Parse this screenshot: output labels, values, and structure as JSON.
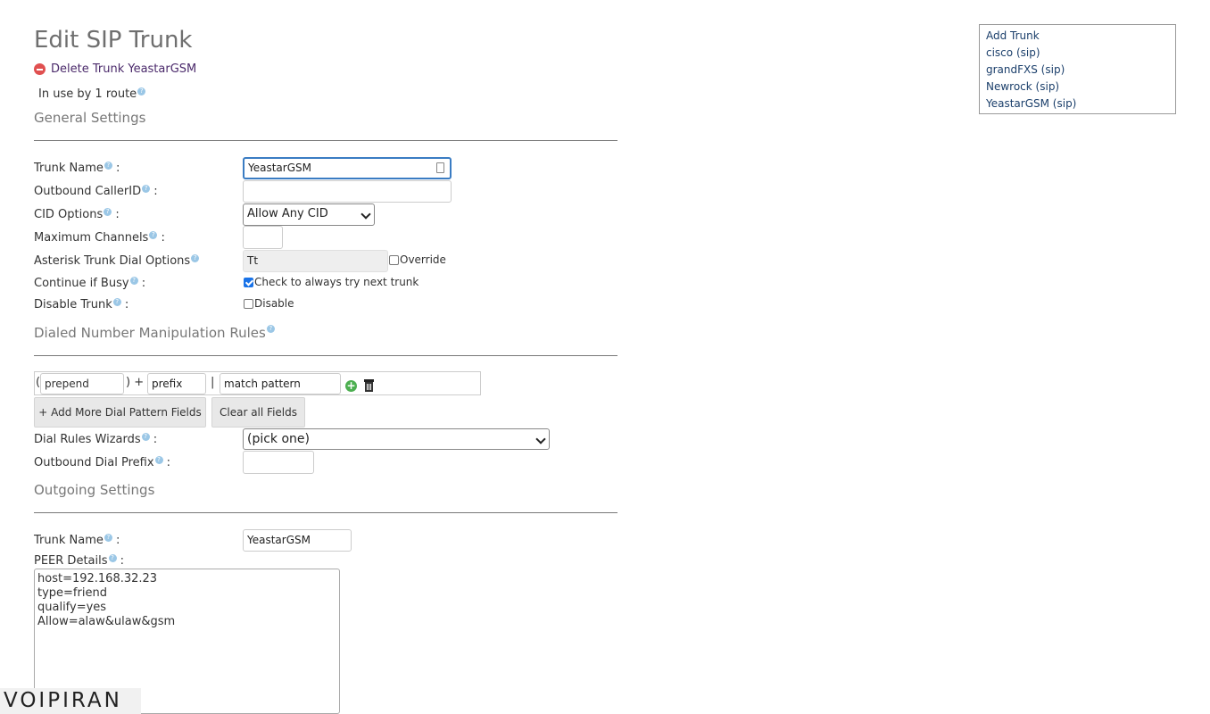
{
  "page": {
    "title": "Edit SIP Trunk",
    "delete_label": "Delete Trunk YeastarGSM",
    "in_use": "In use by 1 route"
  },
  "general": {
    "section_title": "General Settings",
    "trunk_name_label": "Trunk Name",
    "trunk_name_value": "YeastarGSM",
    "callerid_label": "Outbound CallerID",
    "callerid_value": "",
    "cid_options_label": "CID Options",
    "cid_options_value": "Allow Any CID",
    "max_channels_label": "Maximum Channels",
    "max_channels_value": "",
    "dial_options_label": "Asterisk Trunk Dial Options",
    "dial_options_value": "Tt",
    "override_label": "Override",
    "continue_busy_label": "Continue if Busy",
    "continue_busy_check_label": "Check to always try next trunk",
    "disable_trunk_label": "Disable Trunk",
    "disable_check_label": "Disable"
  },
  "dial_rules": {
    "section_title": "Dialed Number Manipulation Rules",
    "prepend_placeholder": "prepend",
    "prefix_placeholder": "prefix",
    "match_placeholder": "match pattern",
    "open_paren": "(",
    "close_plus": ") +",
    "pipe": "|",
    "add_more_button": "+ Add More Dial Pattern Fields",
    "clear_button": "Clear all Fields",
    "wizard_label": "Dial Rules Wizards",
    "wizard_value": "(pick one)",
    "outbound_prefix_label": "Outbound Dial Prefix",
    "outbound_prefix_value": ""
  },
  "outgoing": {
    "section_title": "Outgoing Settings",
    "trunk_name_label": "Trunk Name",
    "trunk_name_value": "YeastarGSM",
    "peer_details_label": "PEER Details",
    "peer_details_value": "host=192.168.32.23\ntype=friend\nqualify=yes\nAllow=alaw&ulaw&gsm"
  },
  "sidebar": {
    "items": [
      "Add Trunk",
      "cisco (sip)",
      "grandFXS (sip)",
      "Newrock (sip)",
      "YeastarGSM (sip)"
    ]
  },
  "logo": {
    "text": "VOIPIRAN"
  },
  "colors": {
    "accent": "#3a7cc3",
    "help_icon": "#9bc7e6",
    "delete_icon": "#e05050",
    "add_icon": "#4caf50",
    "link": "#1b3f6b"
  },
  "icons": {
    "help": "help-icon",
    "delete": "delete-icon",
    "add": "add-icon",
    "trash": "trash-icon"
  },
  "help_glyph": "?",
  "colon": ":"
}
